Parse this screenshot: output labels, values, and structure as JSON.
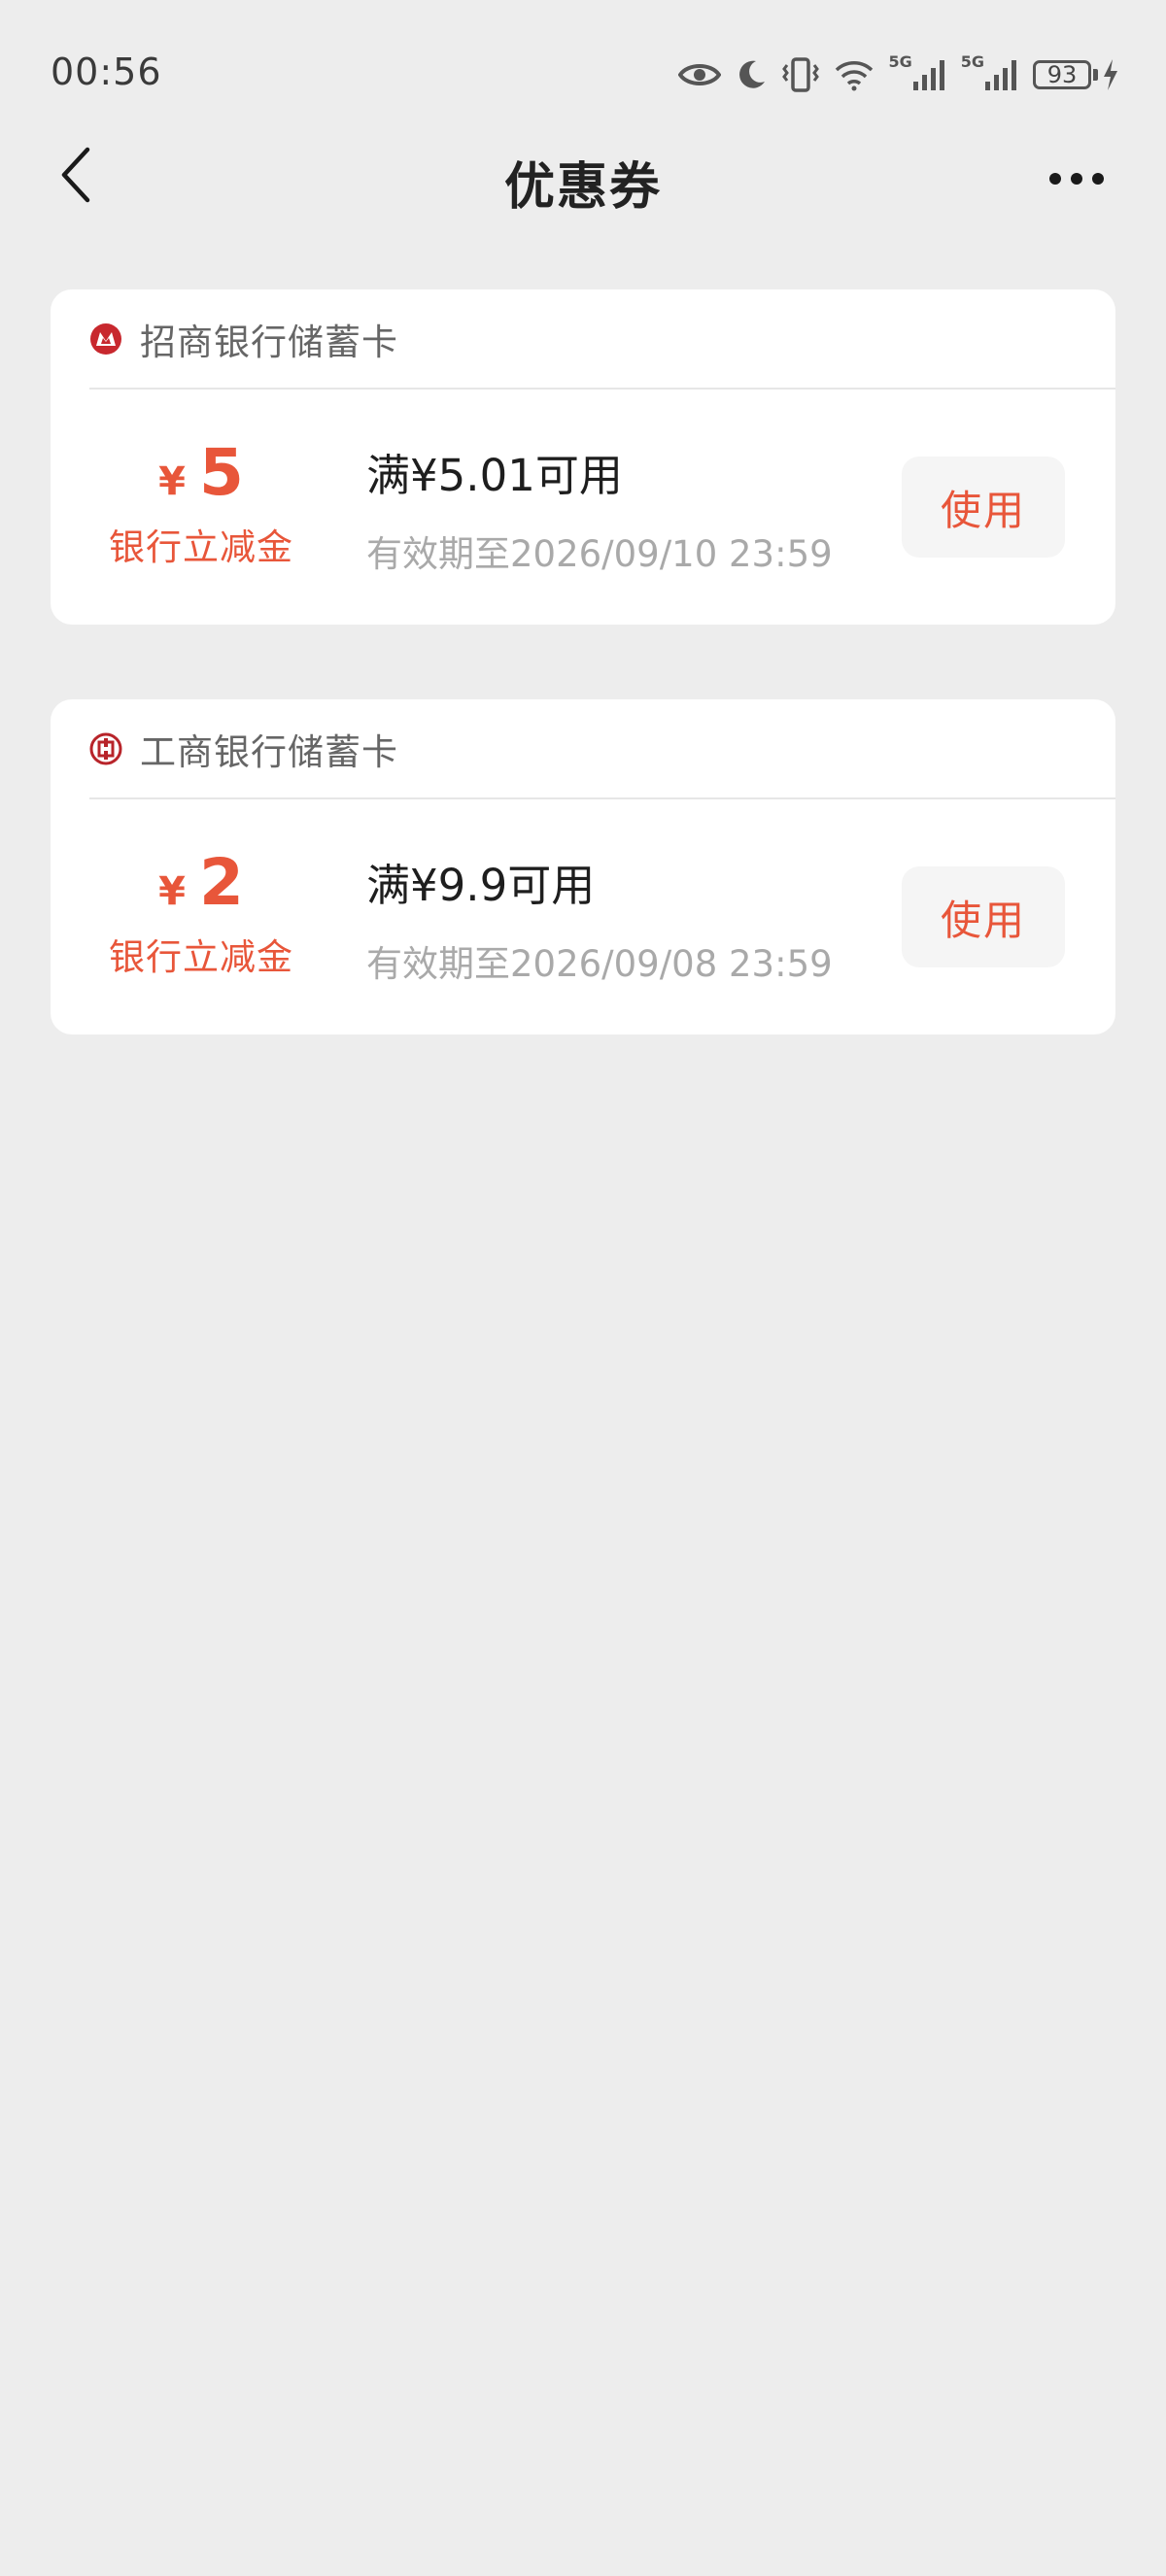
{
  "status_bar": {
    "time": "00:56",
    "battery": "93",
    "signal_1_label": "5G",
    "signal_2_label": "5G"
  },
  "header": {
    "title": "优惠券"
  },
  "colors": {
    "accent": "#e8563a",
    "background": "#ededed",
    "card": "#ffffff",
    "cmb_red": "#c8282e",
    "icbc_red": "#b8242a"
  },
  "coupons": [
    {
      "bank_name": "招商银行储蓄卡",
      "bank_icon": "cmb-logo-icon",
      "currency": "¥",
      "amount": "5",
      "amount_label": "银行立减金",
      "condition": "满¥5.01可用",
      "validity": "有效期至2026/09/10 23:59",
      "action_label": "使用"
    },
    {
      "bank_name": "工商银行储蓄卡",
      "bank_icon": "icbc-logo-icon",
      "currency": "¥",
      "amount": "2",
      "amount_label": "银行立减金",
      "condition": "满¥9.9可用",
      "validity": "有效期至2026/09/08 23:59",
      "action_label": "使用"
    }
  ]
}
